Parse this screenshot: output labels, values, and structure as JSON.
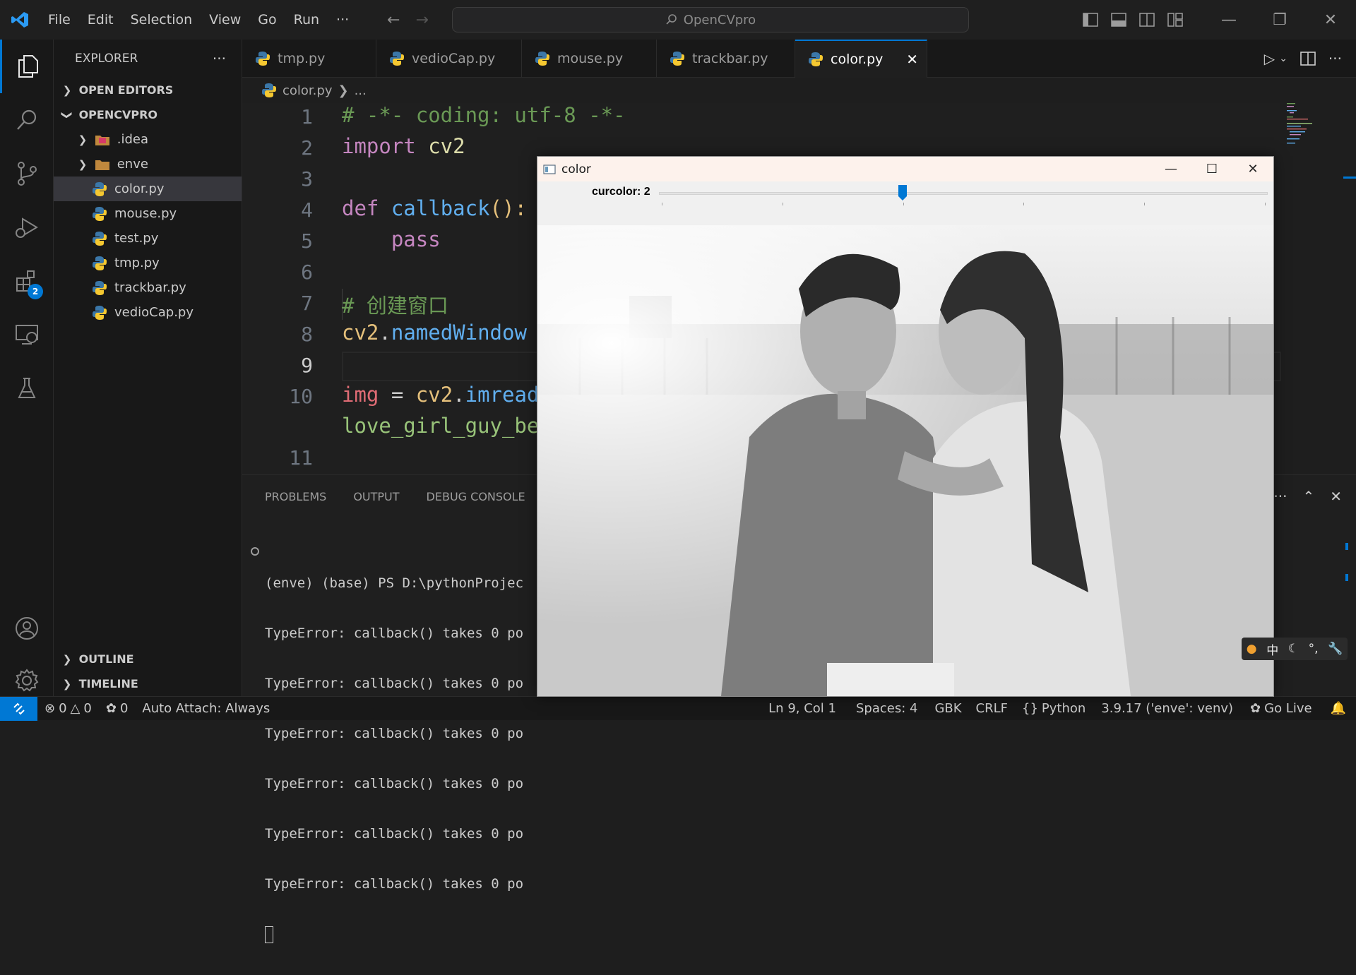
{
  "menu": [
    "File",
    "Edit",
    "Selection",
    "View",
    "Go",
    "Run",
    "···"
  ],
  "command_center": "OpenCVpro",
  "explorer": {
    "title": "EXPLORER",
    "open_editors": "OPEN EDITORS",
    "project": "OPENCVPRO",
    "folders": [
      ".idea",
      "enve"
    ],
    "files": [
      "color.py",
      "mouse.py",
      "test.py",
      "tmp.py",
      "trackbar.py",
      "vedioCap.py"
    ],
    "selected": "color.py",
    "outline": "OUTLINE",
    "timeline": "TIMELINE"
  },
  "activity": {
    "extensions_badge": "2"
  },
  "tabs": [
    "tmp.py",
    "vedioCap.py",
    "mouse.py",
    "trackbar.py",
    "color.py"
  ],
  "active_tab": "color.py",
  "breadcrumb": {
    "file": "color.py",
    "rest": "..."
  },
  "code": {
    "line_numbers": [
      "1",
      "2",
      "3",
      "4",
      "5",
      "6",
      "7",
      "8",
      "9",
      "10",
      "",
      "11"
    ],
    "l1": "# -*- coding: utf-8 -*-",
    "l2_kw": "import",
    "l2_mod": " cv2",
    "l4_kw": "def",
    "l4_fn": " callback",
    "l4_rest": "():",
    "l5": "    pass",
    "l7": "# 创建窗口",
    "l8_obj": "cv2",
    "l8_dot": ".",
    "l8_fn": "namedWindow",
    "l10_var": "img",
    "l10_eq": " = ",
    "l10_obj": "cv2",
    "l10_dot": ".",
    "l10_fn": "imread",
    "l10b": "love_girl_guy_be"
  },
  "panel": {
    "tabs": [
      "PROBLEMS",
      "OUTPUT",
      "DEBUG CONSOLE"
    ],
    "terminal": [
      "(enve) (base) PS D:\\pythonProjec",
      "TypeError: callback() takes 0 po",
      "TypeError: callback() takes 0 po",
      "TypeError: callback() takes 0 po",
      "TypeError: callback() takes 0 po",
      "TypeError: callback() takes 0 po",
      "TypeError: callback() takes 0 po"
    ]
  },
  "status": {
    "errors": "0",
    "warnings": "0",
    "ports": "0",
    "auto_attach": "Auto Attach: Always",
    "position": "Ln 9, Col 1",
    "spaces": "Spaces: 4",
    "encoding": "GBK",
    "eol": "CRLF",
    "language": "Python",
    "interpreter": "3.9.17 ('enve': venv)",
    "go_live": "Go Live"
  },
  "cv_window": {
    "title": "color",
    "trackbar_label": "curcolor: 2",
    "trackbar_value": 2,
    "trackbar_max": 5
  },
  "ime": {
    "lang": "中"
  },
  "colors": {
    "accent": "#0078d4",
    "keyword": "#c586c0",
    "function": "#dcdcaa",
    "comment": "#6a9955"
  }
}
